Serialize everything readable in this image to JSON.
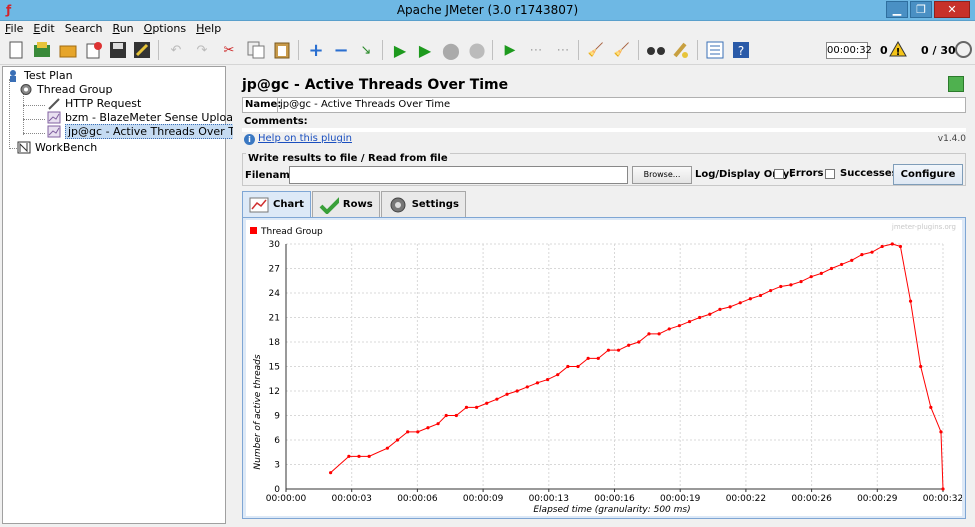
{
  "window": {
    "title": "Apache JMeter (3.0 r1743807)"
  },
  "menu": [
    {
      "mnem": "F",
      "rest": "ile"
    },
    {
      "mnem": "E",
      "rest": "dit"
    },
    {
      "mnem": "",
      "rest": "Search"
    },
    {
      "mnem": "R",
      "rest": "un"
    },
    {
      "mnem": "O",
      "rest": "ptions"
    },
    {
      "mnem": "H",
      "rest": "elp"
    }
  ],
  "toolbar": {
    "elapsed": "00:00:32",
    "error_count": "0",
    "threads": "0 / 30"
  },
  "tree": {
    "test_plan": "Test Plan",
    "thread_group": "Thread Group",
    "http_request": "HTTP Request",
    "uploader": "bzm - BlazeMeter Sense Uploader",
    "active_threads": "jp@gc - Active Threads Over Time",
    "workbench": "WorkBench"
  },
  "panel": {
    "title": "jp@gc - Active Threads Over Time",
    "name_label": "Name:",
    "name_value": "jp@gc - Active Threads Over Time",
    "comments_label": "Comments:",
    "help_link": "Help on this plugin",
    "version": "v1.4.0",
    "write_legend": "Write results to file / Read from file",
    "filename_label": "Filename",
    "filename_value": "",
    "browse_label": "Browse...",
    "log_display_label": "Log/Display Only:",
    "errors_label": "Errors",
    "successes_label": "Successes",
    "configure_label": "Configure"
  },
  "tabs": [
    {
      "label": "Chart",
      "active": true
    },
    {
      "label": "Rows",
      "active": false
    },
    {
      "label": "Settings",
      "active": false
    }
  ],
  "chart_data": {
    "type": "line",
    "watermark": "jmeter-plugins.org",
    "xlabel": "Elapsed time (granularity: 500 ms)",
    "ylabel": "Number of active threads",
    "ylim": [
      0,
      30
    ],
    "yticks": [
      0,
      3,
      6,
      9,
      12,
      15,
      18,
      21,
      24,
      27,
      30
    ],
    "xticks": [
      "00:00:00",
      "00:00:03",
      "00:00:06",
      "00:00:09",
      "00:00:13",
      "00:00:16",
      "00:00:19",
      "00:00:22",
      "00:00:26",
      "00:00:29",
      "00:00:32"
    ],
    "legend_position": "top-left",
    "grid": true,
    "series": [
      {
        "name": "Thread Group",
        "color": "#ff0000",
        "points": [
          [
            2.2,
            2
          ],
          [
            3.1,
            4
          ],
          [
            3.6,
            4
          ],
          [
            4.1,
            4
          ],
          [
            5.0,
            5
          ],
          [
            5.5,
            6
          ],
          [
            6.0,
            7
          ],
          [
            6.5,
            7
          ],
          [
            7.0,
            7.5
          ],
          [
            7.5,
            8
          ],
          [
            7.9,
            9
          ],
          [
            8.4,
            9
          ],
          [
            8.9,
            10
          ],
          [
            9.4,
            10
          ],
          [
            9.9,
            10.5
          ],
          [
            10.4,
            11
          ],
          [
            10.9,
            11.6
          ],
          [
            11.4,
            12
          ],
          [
            11.9,
            12.5
          ],
          [
            12.4,
            13
          ],
          [
            12.9,
            13.4
          ],
          [
            13.4,
            14
          ],
          [
            13.9,
            15
          ],
          [
            14.4,
            15
          ],
          [
            14.9,
            16
          ],
          [
            15.4,
            16
          ],
          [
            15.9,
            17
          ],
          [
            16.4,
            17
          ],
          [
            16.9,
            17.6
          ],
          [
            17.4,
            18
          ],
          [
            17.9,
            19
          ],
          [
            18.4,
            19
          ],
          [
            18.9,
            19.6
          ],
          [
            19.4,
            20
          ],
          [
            19.9,
            20.5
          ],
          [
            20.4,
            21
          ],
          [
            20.9,
            21.4
          ],
          [
            21.4,
            22
          ],
          [
            21.9,
            22.3
          ],
          [
            22.4,
            22.8
          ],
          [
            22.9,
            23.3
          ],
          [
            23.4,
            23.7
          ],
          [
            23.9,
            24.3
          ],
          [
            24.4,
            24.8
          ],
          [
            24.9,
            25
          ],
          [
            25.4,
            25.4
          ],
          [
            25.9,
            26
          ],
          [
            26.4,
            26.4
          ],
          [
            26.9,
            27
          ],
          [
            27.4,
            27.5
          ],
          [
            27.9,
            28
          ],
          [
            28.4,
            28.7
          ],
          [
            28.9,
            29
          ],
          [
            29.4,
            29.7
          ],
          [
            29.9,
            30
          ],
          [
            30.3,
            29.7
          ],
          [
            30.8,
            23
          ],
          [
            31.3,
            15
          ],
          [
            31.8,
            10
          ],
          [
            32.3,
            7
          ],
          [
            32.4,
            0
          ]
        ]
      }
    ]
  }
}
